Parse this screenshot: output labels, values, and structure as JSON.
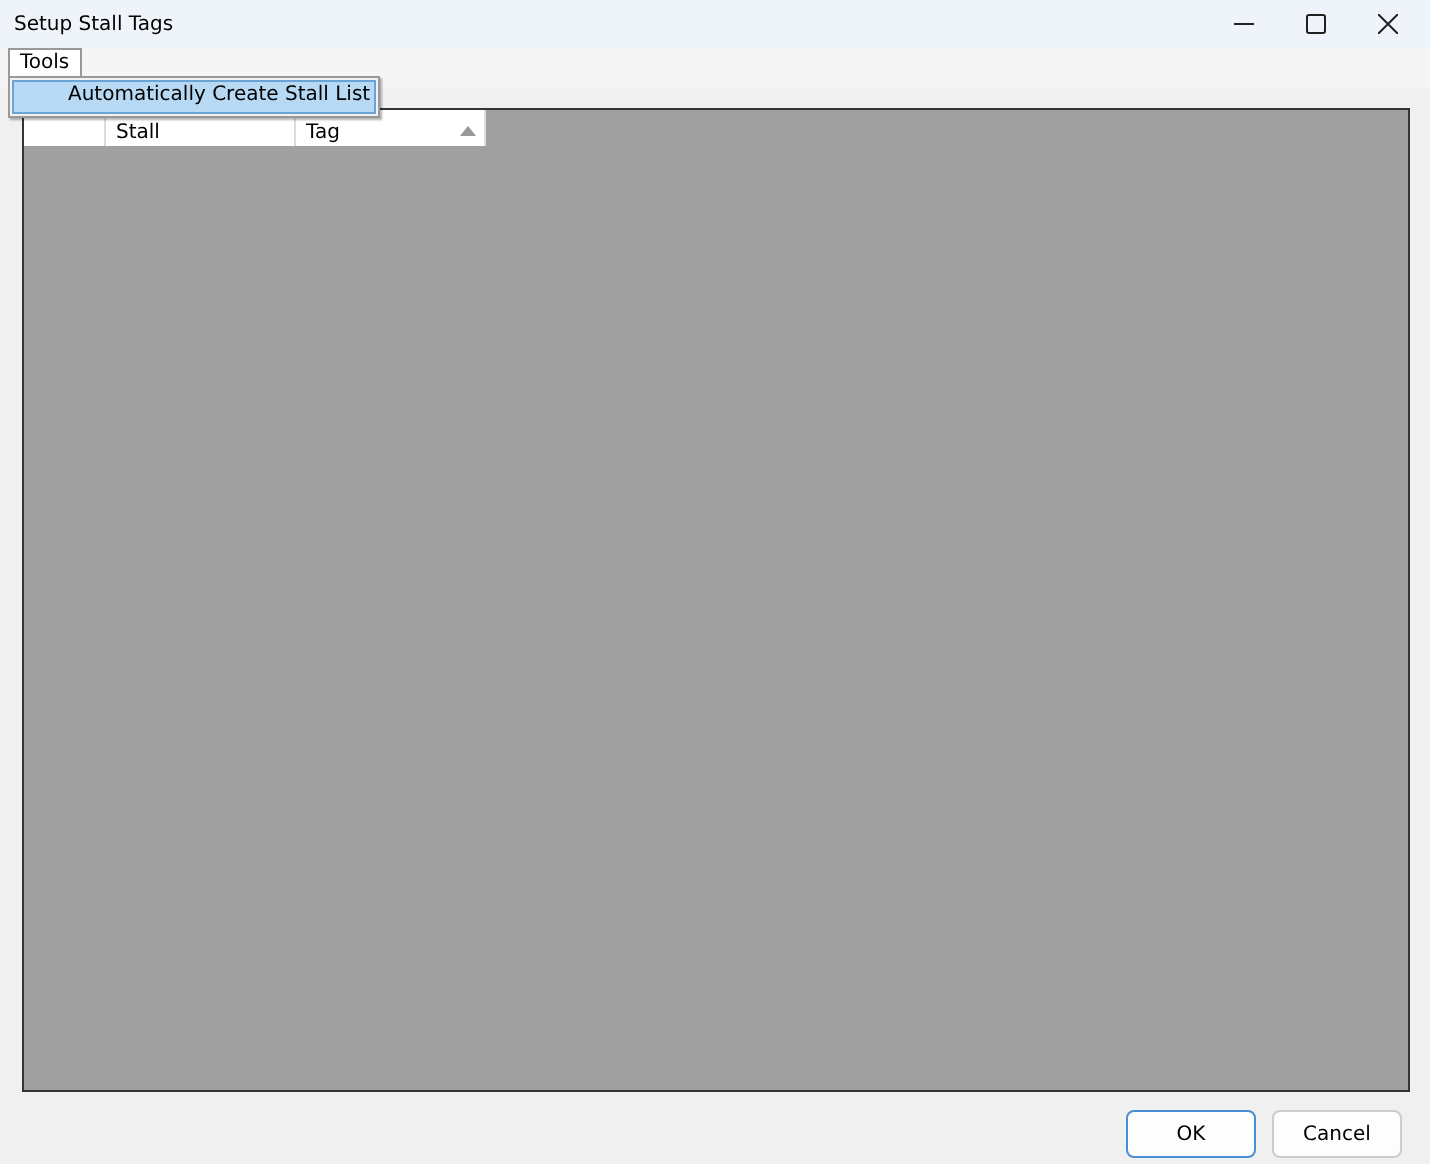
{
  "window": {
    "title": "Setup Stall Tags"
  },
  "menu": {
    "label": "Tools",
    "expanded": true,
    "items": [
      {
        "label": "Automatically Create Stall List",
        "selected": true
      }
    ]
  },
  "table": {
    "columns": [
      {
        "label": "Stall",
        "sorted": false
      },
      {
        "label": "Tag",
        "sorted": true
      }
    ]
  },
  "buttons": [
    {
      "label": "OK",
      "default": true
    },
    {
      "label": "Cancel",
      "default": false
    }
  ]
}
